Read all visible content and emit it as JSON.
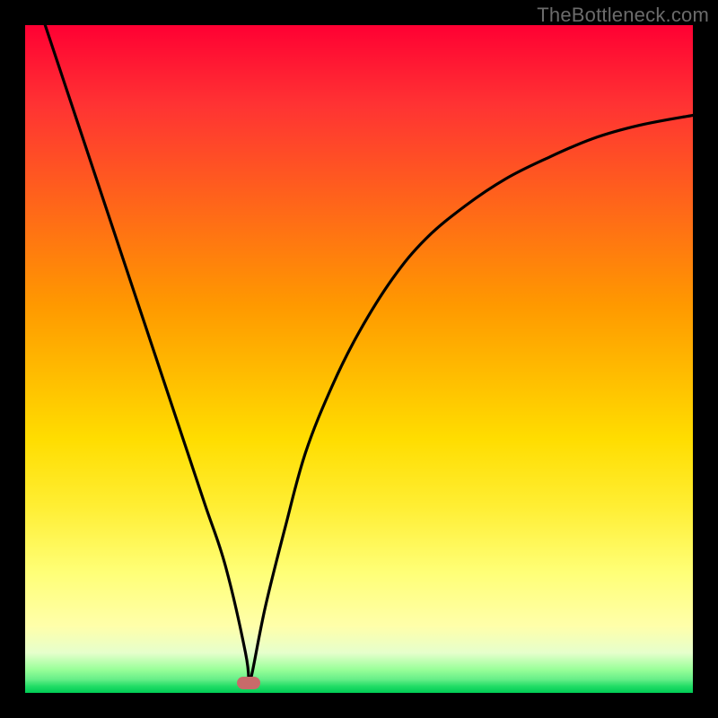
{
  "watermark": "TheBottleneck.com",
  "chart_data": {
    "type": "line",
    "title": "",
    "xlabel": "",
    "ylabel": "",
    "xlim": [
      0,
      100
    ],
    "ylim": [
      0,
      100
    ],
    "grid": false,
    "legend": false,
    "background": "gradient-red-to-green",
    "series": [
      {
        "name": "curve",
        "x": [
          3,
          6,
          9,
          12,
          15,
          18,
          21,
          24,
          27,
          30,
          33,
          33.5,
          34,
          36,
          39,
          42,
          46,
          50,
          55,
          60,
          66,
          72,
          78,
          85,
          92,
          100
        ],
        "values": [
          100,
          91,
          82,
          73,
          64,
          55,
          46,
          37,
          28,
          19,
          6,
          1.5,
          3,
          13,
          25,
          36,
          46,
          54,
          62,
          68,
          73,
          77,
          80,
          83,
          85,
          86.5
        ]
      }
    ],
    "marker": {
      "x": 33.5,
      "y": 1.5,
      "shape": "pill",
      "color": "#c86a6a"
    }
  }
}
